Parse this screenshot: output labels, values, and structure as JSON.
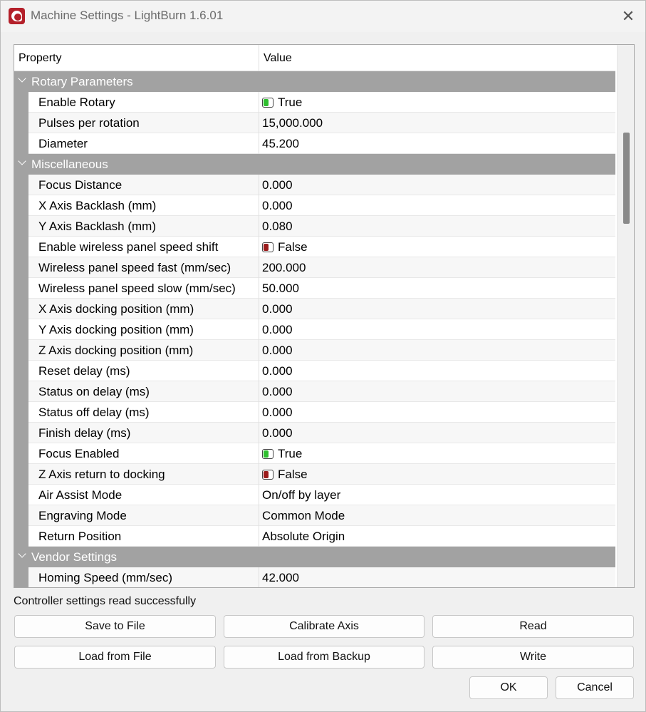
{
  "window": {
    "title": "Machine Settings - LightBurn 1.6.01",
    "close_symbol": "✕"
  },
  "grid": {
    "columns": {
      "property": "Property",
      "value": "Value"
    },
    "sections": [
      {
        "title": "Rotary Parameters",
        "rows": [
          {
            "name": "Enable Rotary",
            "value": "True",
            "toggle": "on"
          },
          {
            "name": "Pulses per rotation",
            "value": "15,000.000"
          },
          {
            "name": "Diameter",
            "value": "45.200"
          }
        ]
      },
      {
        "title": "Miscellaneous",
        "rows": [
          {
            "name": "Focus Distance",
            "value": "0.000"
          },
          {
            "name": "X Axis Backlash (mm)",
            "value": "0.000"
          },
          {
            "name": "Y Axis Backlash (mm)",
            "value": "0.080"
          },
          {
            "name": "Enable wireless panel speed shift",
            "value": "False",
            "toggle": "off"
          },
          {
            "name": "Wireless panel speed fast (mm/sec)",
            "value": "200.000"
          },
          {
            "name": "Wireless panel speed slow (mm/sec)",
            "value": "50.000"
          },
          {
            "name": "X Axis docking position (mm)",
            "value": "0.000"
          },
          {
            "name": "Y Axis docking position (mm)",
            "value": "0.000"
          },
          {
            "name": "Z Axis docking position (mm)",
            "value": "0.000"
          },
          {
            "name": "Reset delay (ms)",
            "value": "0.000"
          },
          {
            "name": "Status on delay (ms)",
            "value": "0.000"
          },
          {
            "name": "Status off delay (ms)",
            "value": "0.000"
          },
          {
            "name": "Finish delay (ms)",
            "value": "0.000"
          },
          {
            "name": "Focus Enabled",
            "value": "True",
            "toggle": "on"
          },
          {
            "name": "Z Axis return to docking",
            "value": "False",
            "toggle": "off"
          },
          {
            "name": "Air Assist Mode",
            "value": "On/off by layer"
          },
          {
            "name": "Engraving Mode",
            "value": "Common Mode"
          },
          {
            "name": "Return Position",
            "value": "Absolute Origin"
          }
        ]
      },
      {
        "title": "Vendor Settings",
        "rows": [
          {
            "name": "Homing Speed (mm/sec)",
            "value": "42.000"
          }
        ]
      }
    ]
  },
  "status_text": "Controller settings read successfully",
  "buttons": {
    "save_to_file": "Save to File",
    "calibrate_axis": "Calibrate Axis",
    "read": "Read",
    "load_from_file": "Load from File",
    "load_from_backup": "Load from Backup",
    "write": "Write",
    "ok": "OK",
    "cancel": "Cancel"
  },
  "colors": {
    "section_header": "#a2a2a2",
    "toggle_on": "#2fbf2f",
    "toggle_off": "#9b1c1c",
    "app_icon": "#b4202a"
  },
  "icons": {
    "app": "lightburn-app-icon",
    "close": "close-icon",
    "expand": "chevron-down-icon",
    "toggle_on": "toggle-on-icon",
    "toggle_off": "toggle-off-icon"
  }
}
